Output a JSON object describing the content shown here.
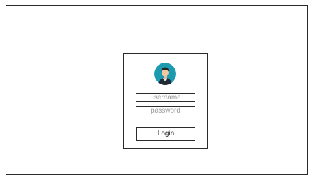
{
  "login": {
    "avatar_icon": "user-avatar-icon",
    "username_placeholder": "username",
    "password_placeholder": "password",
    "login_label": "Login"
  },
  "colors": {
    "avatar_background": "#1c9bb0",
    "border": "#2b2b2b",
    "placeholder_text": "#9a9a9a"
  }
}
